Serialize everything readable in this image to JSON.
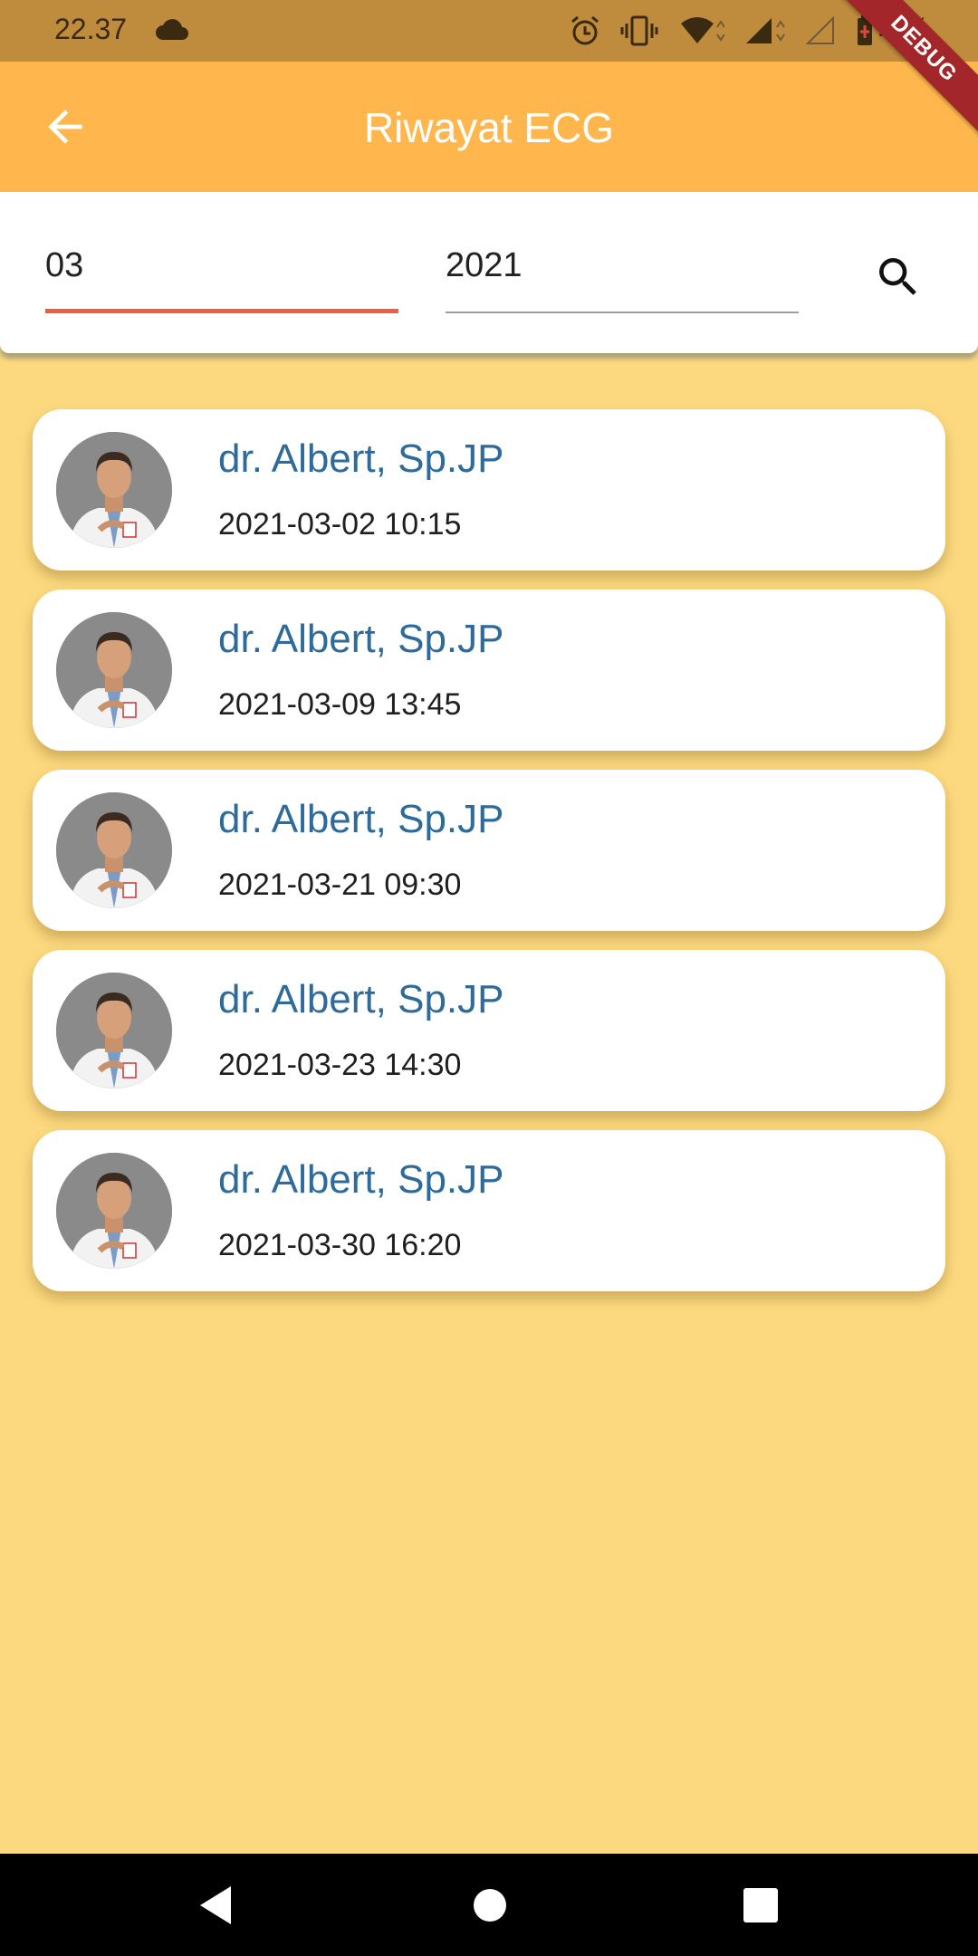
{
  "status_bar": {
    "time": "22.37",
    "battery": "73%",
    "icons": [
      "cloud-icon",
      "alarm-icon",
      "vibrate-icon",
      "wifi-icon",
      "signal-icon",
      "signal-empty-icon",
      "battery-icon"
    ]
  },
  "debug_banner": "DEBUG",
  "app_bar": {
    "title": "Riwayat ECG",
    "back_icon": "arrow-left-icon"
  },
  "search": {
    "month_value": "03",
    "year_value": "2021",
    "search_icon": "search-icon"
  },
  "records": [
    {
      "doctor": "dr. Albert, Sp.JP",
      "datetime": "2021-03-02 10:15"
    },
    {
      "doctor": "dr. Albert, Sp.JP",
      "datetime": "2021-03-09 13:45"
    },
    {
      "doctor": "dr. Albert, Sp.JP",
      "datetime": "2021-03-21 09:30"
    },
    {
      "doctor": "dr. Albert, Sp.JP",
      "datetime": "2021-03-23 14:30"
    },
    {
      "doctor": "dr. Albert, Sp.JP",
      "datetime": "2021-03-30 16:20"
    }
  ],
  "nav_bar": {
    "buttons": [
      "back-triangle-icon",
      "home-circle-icon",
      "recents-square-icon"
    ]
  },
  "colors": {
    "app_bar": "#ffb74d",
    "background": "#fcd97e",
    "doctor_name": "#2e6b9a",
    "month_underline": "#ef5e3b",
    "debug_ribbon": "#a3272a"
  }
}
